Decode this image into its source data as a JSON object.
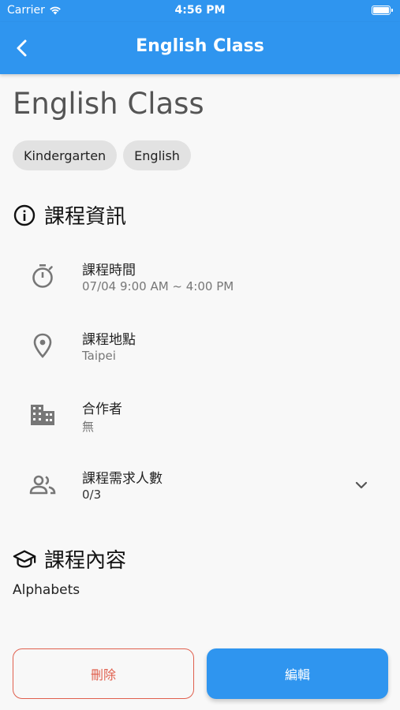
{
  "status_bar": {
    "carrier": "Carrier",
    "time": "4:56 PM"
  },
  "app_bar": {
    "title": "English Class"
  },
  "course": {
    "title": "English Class",
    "tags": [
      "Kindergarten",
      "English"
    ]
  },
  "info_section": {
    "title": "課程資訊",
    "rows": [
      {
        "icon": "timer-icon",
        "label": "課程時間",
        "value": "07/04 9:00 AM ~ 4:00 PM"
      },
      {
        "icon": "location-pin-icon",
        "label": "課程地點",
        "value": "Taipei"
      },
      {
        "icon": "building-icon",
        "label": "合作者",
        "value": "無"
      },
      {
        "icon": "people-icon",
        "label": "課程需求人數",
        "value": "0/3"
      }
    ]
  },
  "content_section": {
    "title": "課程內容",
    "text": "Alphabets"
  },
  "actions": {
    "delete_label": "刪除",
    "edit_label": "編輯"
  },
  "colors": {
    "primary": "#2f95ef",
    "danger": "#e0604e",
    "background": "#f8f8f8",
    "chip": "#e2e2e2"
  }
}
